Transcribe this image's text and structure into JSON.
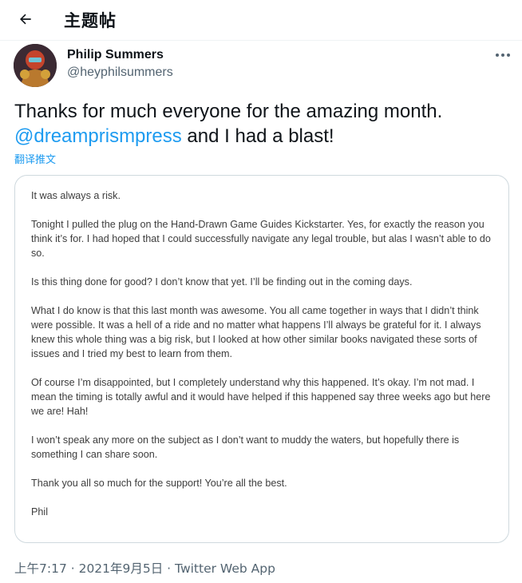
{
  "header": {
    "title": "主题帖"
  },
  "author": {
    "display_name": "Philip Summers",
    "handle": "@heyphilsummers"
  },
  "tweet": {
    "text_line1": "Thanks for much everyone for the amazing month.",
    "mention": "@dreamprismpress",
    "text_after_mention": " and I had a blast!",
    "translate_label": "翻译推文"
  },
  "note": {
    "paragraphs": [
      "It was always a risk.",
      "Tonight I pulled the plug on the Hand-Drawn Game Guides Kickstarter. Yes, for exactly the reason you think it’s for. I had hoped that I could successfully navigate any legal trouble, but alas I wasn’t able to do so.",
      "Is this thing done for good? I don’t know that yet. I’ll be finding out in the coming days.",
      "What I do know is that this last month was awesome. You all came together in ways that I didn’t think were possible. It was a hell of a ride and no matter what happens I’ll always be grateful for it. I always knew this whole thing was a big risk, but I looked at how other similar books navigated these sorts of issues and I tried my best to learn from them.",
      "Of course I’m disappointed, but I completely understand why this happened. It’s okay. I’m not mad. I mean the timing is totally awful and it would have helped if this happened say three weeks ago but here we are! Hah!",
      "I won’t speak any more on the subject as I don’t want to muddy the waters, but hopefully there is something I can share soon.",
      "Thank you all so much for the support! You’re all the best.",
      "Phil"
    ]
  },
  "meta": {
    "text": "上午7:17 · 2021年9月5日 · Twitter Web App"
  },
  "icons": {
    "back": "arrow-left-icon",
    "more": "more-horizontal-icon"
  },
  "colors": {
    "accent": "#1d9bf0",
    "secondary_text": "#536471"
  }
}
